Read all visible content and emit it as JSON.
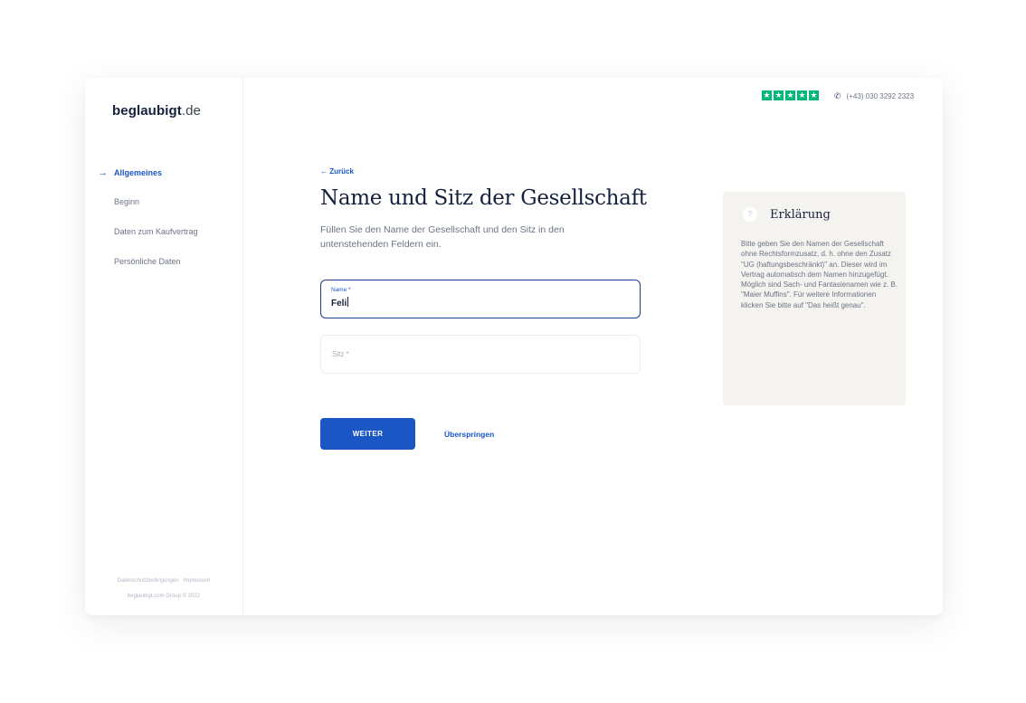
{
  "brand": {
    "name": "beglaubigt",
    "tld": ".de"
  },
  "nav": {
    "items": [
      {
        "label": "Allgemeines",
        "active": true
      },
      {
        "label": "Beginn",
        "active": false
      },
      {
        "label": "Daten zum Kaufvertrag",
        "active": false
      },
      {
        "label": "Persönliche Daten",
        "active": false
      }
    ]
  },
  "footer": {
    "links_line": "Datenschutzbedingungen   Impressum",
    "copyright": "beglaubigt.com Group © 2022"
  },
  "topbar": {
    "rating_stars": 5,
    "phone": "(+43) 030 3292 2323"
  },
  "form": {
    "back_label": "← Zurück",
    "title": "Name und Sitz der Gesellschaft",
    "subtitle": "Füllen Sie den Name der Gesellschaft und den Sitz in den untenstehenden Feldern ein.",
    "name_label": "Name *",
    "name_value": "Feli",
    "sitz_placeholder": "Sitz *",
    "next_button": "WEITER",
    "skip_link": "Überspringen"
  },
  "explanation": {
    "heading": "Erklärung",
    "text": "Bitte geben Sie den Namen der Gesellschaft ohne Rechtsformzusatz, d. h. ohne den Zusatz \"UG (haftungsbeschränkt)\" an. Dieser wird im Vertrag automatisch dem Namen hinzugefügt. Möglich sind Sach- und Fantasienamen wie z. B. \"Maier Muffins\". Für weitere Informationen klicken Sie bitte auf \"Das heißt genau\"."
  },
  "colors": {
    "accent": "#1a56c4",
    "trustpilot": "#00b67a",
    "panel": "#f4f3f0"
  }
}
